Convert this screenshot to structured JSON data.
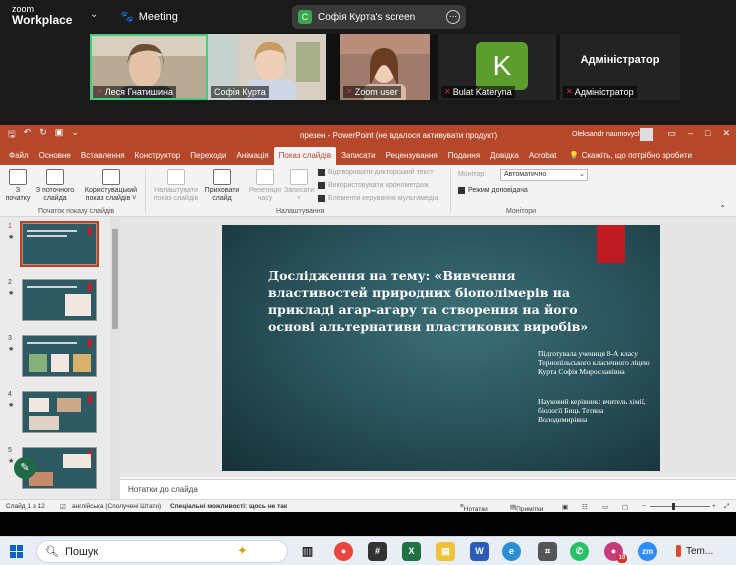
{
  "zoom": {
    "logo_line1": "zoom",
    "logo_line2": "Workplace",
    "meeting_label": "Meeting",
    "share_badge_letter": "C",
    "share_label": "Софія Курта's screen"
  },
  "participants": [
    {
      "name": "Леся Гнатишина",
      "muted": true
    },
    {
      "name": "Софія Курта",
      "muted": false
    },
    {
      "name": "Zoom user",
      "muted": true
    },
    {
      "name": "Bulat Kateryna",
      "muted": true,
      "avatar_letter": "K"
    },
    {
      "name": "Адміністратор",
      "muted": true,
      "tile_title": "Адміністратор"
    }
  ],
  "ppt": {
    "window_title": "презен  -  PowerPoint (не вдалося активувати продукт)",
    "user": "Oleksandr naumovych",
    "tabs": [
      "Файл",
      "Основне",
      "Вставлення",
      "Конструктор",
      "Переходи",
      "Анімація",
      "Показ слайдів",
      "Записати",
      "Рецензування",
      "Подання",
      "Довідка",
      "Acrobat"
    ],
    "selected_tab": "Показ слайдів",
    "tell_me": "Скажіть, що потрібно зробити",
    "ribbon": {
      "from_start_1": "З",
      "from_start_2": "початку",
      "from_current_1": "З поточного",
      "from_current_2": "слайда",
      "custom_1": "Користувацький",
      "custom_2": "показ слайдів ˅",
      "group_start": "Початок показу слайдів",
      "setup_1": "Налаштувати",
      "setup_2": "показ слайдів",
      "hide_1": "Приховати",
      "hide_2": "слайд",
      "rehearse_1": "Репетиція",
      "rehearse_2": "часу",
      "record_1": "Записати",
      "record_2": "˅",
      "chk_narration": "Відтворювати дикторський текст",
      "chk_timings": "Використовувати хронометраж",
      "chk_media": "Елементи керування мультимедіа",
      "group_setup": "Налаштування",
      "monitor_label": "Монітор:",
      "monitor_value": "Автоматично",
      "presenter_view": "Режим доповідача",
      "group_monitors": "Монітори"
    },
    "slides": [
      "1",
      "2",
      "3",
      "4",
      "5"
    ],
    "slide": {
      "title": "Дослідження на тему: «Вивчення властивостей природних біополімерів на прикладі агар-агару та створення на його основі альтернативи пластикових виробів»",
      "author": "Підготувала учениця 8-А класу Тернопільського класичного ліцею Курта Софія Мирославівна",
      "supervisor": "Науковий керівник: вчитель хімії, біології Биць Тетяна Володимирівна"
    },
    "notes_placeholder": "Нотатки до слайда",
    "status": {
      "slide_counter": "Слайд 1 з 12",
      "language": "англійська (Сполучені Штати)",
      "accessibility": "Спеціальні можливості: щось не так",
      "notes_btn": "Нотатки",
      "comments_btn": "Примітки"
    }
  },
  "taskbar": {
    "search_label": "Пошук",
    "zoom_badge": "10",
    "weather": "Tem..."
  },
  "colors": {
    "ppt_accent": "#b7472a",
    "slide_bg": "#284f57",
    "zoom_active": "#3ed07a"
  }
}
